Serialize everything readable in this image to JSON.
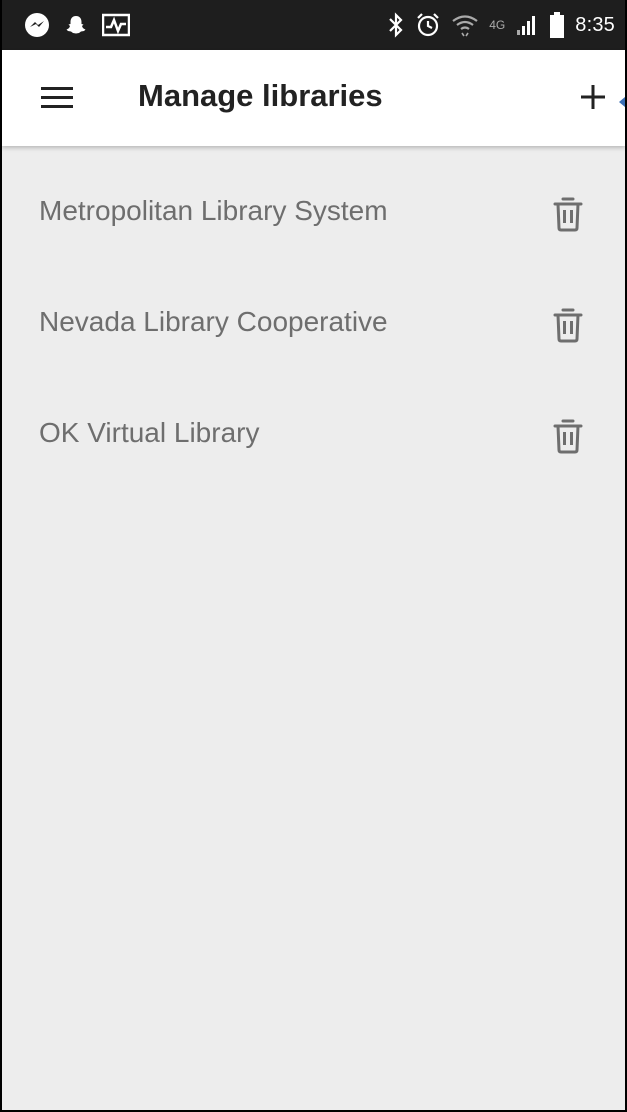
{
  "status_bar": {
    "time": "8:35",
    "left_icons": [
      "messenger-icon",
      "snapchat-icon",
      "activity-icon"
    ],
    "right_icons": [
      "bluetooth-icon",
      "alarm-icon",
      "wifi-icon",
      "lte-icon",
      "signal-icon",
      "battery-icon"
    ],
    "network_label": "4G"
  },
  "app_bar": {
    "title": "Manage libraries",
    "add_label": "+"
  },
  "libraries": [
    {
      "name": "Metropolitan Library System"
    },
    {
      "name": "Nevada Library Cooperative"
    },
    {
      "name": "OK Virtual Library"
    }
  ],
  "colors": {
    "status_bar_bg": "#1e1e1e",
    "app_bar_bg": "#ffffff",
    "content_bg": "#ededed",
    "item_text": "#6e6e6e",
    "title_text": "#222222",
    "icon_gray": "#6e6e6e"
  }
}
